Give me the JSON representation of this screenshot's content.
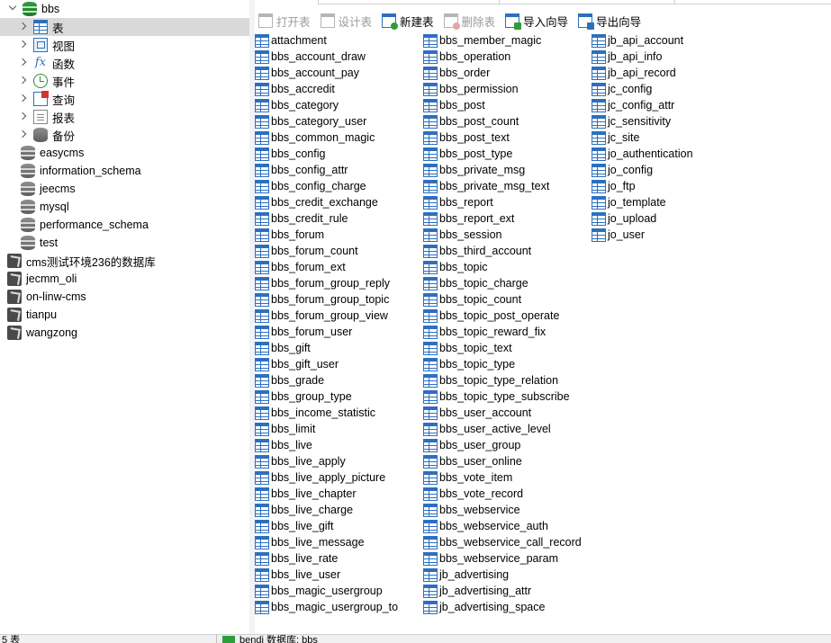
{
  "nav": {
    "items": [
      {
        "label": "bbs",
        "icon": "database-icon",
        "level": 0,
        "chevron": "open",
        "selected": false
      },
      {
        "label": "表",
        "icon": "table-icon",
        "level": 1,
        "chevron": "closed",
        "selected": true
      },
      {
        "label": "视图",
        "icon": "view-icon",
        "level": 1,
        "chevron": "closed",
        "selected": false
      },
      {
        "label": "函数",
        "icon": "function-icon",
        "level": 1,
        "chevron": "closed",
        "selected": false
      },
      {
        "label": "事件",
        "icon": "event-icon",
        "level": 1,
        "chevron": "closed",
        "selected": false
      },
      {
        "label": "查询",
        "icon": "query-icon",
        "level": 1,
        "chevron": "closed",
        "selected": false
      },
      {
        "label": "报表",
        "icon": "report-icon",
        "level": 1,
        "chevron": "closed",
        "selected": false
      },
      {
        "label": "备份",
        "icon": "backup-icon",
        "level": 1,
        "chevron": "closed",
        "selected": false
      },
      {
        "label": "easycms",
        "icon": "database-icon",
        "level": 0,
        "chevron": "none",
        "selected": false
      },
      {
        "label": "information_schema",
        "icon": "database-icon",
        "level": 0,
        "chevron": "none",
        "selected": false
      },
      {
        "label": "jeecms",
        "icon": "database-icon",
        "level": 0,
        "chevron": "none",
        "selected": false
      },
      {
        "label": "mysql",
        "icon": "database-icon",
        "level": 0,
        "chevron": "none",
        "selected": false
      },
      {
        "label": "performance_schema",
        "icon": "database-icon",
        "level": 0,
        "chevron": "none",
        "selected": false
      },
      {
        "label": "test",
        "icon": "database-icon",
        "level": 0,
        "chevron": "none",
        "selected": false
      },
      {
        "label": "cms测试环境236的数据库",
        "icon": "connection-icon",
        "level": -1,
        "chevron": "none",
        "selected": false
      },
      {
        "label": "jecmm_oli",
        "icon": "connection-icon",
        "level": -1,
        "chevron": "none",
        "selected": false
      },
      {
        "label": "on-linw-cms",
        "icon": "connection-icon",
        "level": -1,
        "chevron": "none",
        "selected": false
      },
      {
        "label": "tianpu",
        "icon": "connection-icon",
        "level": -1,
        "chevron": "none",
        "selected": false
      },
      {
        "label": "wangzong",
        "icon": "connection-icon",
        "level": -1,
        "chevron": "none",
        "selected": false
      }
    ]
  },
  "toolbar": {
    "open_table": "打开表",
    "design_table": "设计表",
    "new_table": "新建表",
    "delete_table": "删除表",
    "import_wizard": "导入向导",
    "export_wizard": "导出向导"
  },
  "tables": {
    "columns": [
      [
        "attachment",
        "bbs_account_draw",
        "bbs_account_pay",
        "bbs_accredit",
        "bbs_category",
        "bbs_category_user",
        "bbs_common_magic",
        "bbs_config",
        "bbs_config_attr",
        "bbs_config_charge",
        "bbs_credit_exchange",
        "bbs_credit_rule",
        "bbs_forum",
        "bbs_forum_count",
        "bbs_forum_ext",
        "bbs_forum_group_reply",
        "bbs_forum_group_topic",
        "bbs_forum_group_view",
        "bbs_forum_user",
        "bbs_gift",
        "bbs_gift_user",
        "bbs_grade",
        "bbs_group_type",
        "bbs_income_statistic",
        "bbs_limit",
        "bbs_live",
        "bbs_live_apply",
        "bbs_live_apply_picture",
        "bbs_live_chapter",
        "bbs_live_charge",
        "bbs_live_gift",
        "bbs_live_message",
        "bbs_live_rate",
        "bbs_live_user",
        "bbs_magic_usergroup",
        "bbs_magic_usergroup_to"
      ],
      [
        "bbs_member_magic",
        "bbs_operation",
        "bbs_order",
        "bbs_permission",
        "bbs_post",
        "bbs_post_count",
        "bbs_post_text",
        "bbs_post_type",
        "bbs_private_msg",
        "bbs_private_msg_text",
        "bbs_report",
        "bbs_report_ext",
        "bbs_session",
        "bbs_third_account",
        "bbs_topic",
        "bbs_topic_charge",
        "bbs_topic_count",
        "bbs_topic_post_operate",
        "bbs_topic_reward_fix",
        "bbs_topic_text",
        "bbs_topic_type",
        "bbs_topic_type_relation",
        "bbs_topic_type_subscribe",
        "bbs_user_account",
        "bbs_user_active_level",
        "bbs_user_group",
        "bbs_user_online",
        "bbs_vote_item",
        "bbs_vote_record",
        "bbs_webservice",
        "bbs_webservice_auth",
        "bbs_webservice_call_record",
        "bbs_webservice_param",
        "jb_advertising",
        "jb_advertising_attr",
        "jb_advertising_space"
      ],
      [
        "jb_api_account",
        "jb_api_info",
        "jb_api_record",
        "jc_config",
        "jc_config_attr",
        "jc_sensitivity",
        "jc_site",
        "jo_authentication",
        "jo_config",
        "jo_ftp",
        "jo_template",
        "jo_upload",
        "jo_user"
      ]
    ]
  },
  "status": {
    "left_text": "5 表",
    "right_text": "bendi   数据库: bbs"
  },
  "colors": {
    "accent": "#2d6fbf",
    "selected_row": "#d9d9d9",
    "db_active": "#2e9e3a"
  }
}
